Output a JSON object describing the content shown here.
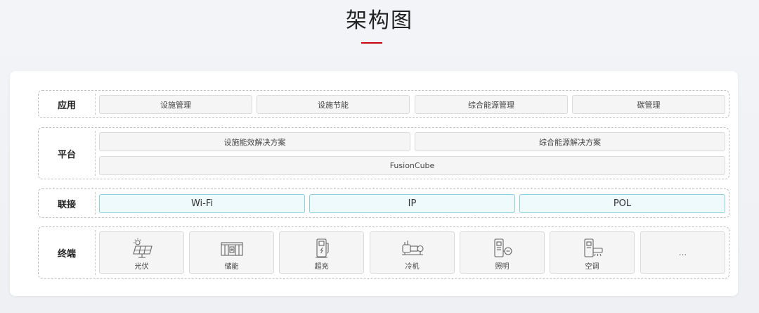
{
  "header": {
    "title": "架构图"
  },
  "layers": {
    "app": {
      "label": "应用",
      "items": [
        "设施管理",
        "设施节能",
        "综合能源管理",
        "碳管理"
      ]
    },
    "platform": {
      "label": "平台",
      "solutions": [
        "设施能效解决方案",
        "综合能源解决方案"
      ],
      "base": "FusionCube"
    },
    "connect": {
      "label": "联接",
      "items": [
        "Wi-Fi",
        "IP",
        "POL"
      ]
    },
    "terminal": {
      "label": "终端",
      "items": [
        {
          "label": "光伏",
          "icon": "solar-panel-icon"
        },
        {
          "label": "储能",
          "icon": "energy-storage-icon"
        },
        {
          "label": "超充",
          "icon": "ev-charger-icon"
        },
        {
          "label": "冷机",
          "icon": "chiller-icon"
        },
        {
          "label": "照明",
          "icon": "lighting-icon"
        },
        {
          "label": "空调",
          "icon": "air-conditioner-icon"
        }
      ],
      "more": "..."
    }
  },
  "colors": {
    "accent": "#c7000b",
    "connect_border": "#8ccfdc",
    "connect_fill": "#eefafc"
  }
}
